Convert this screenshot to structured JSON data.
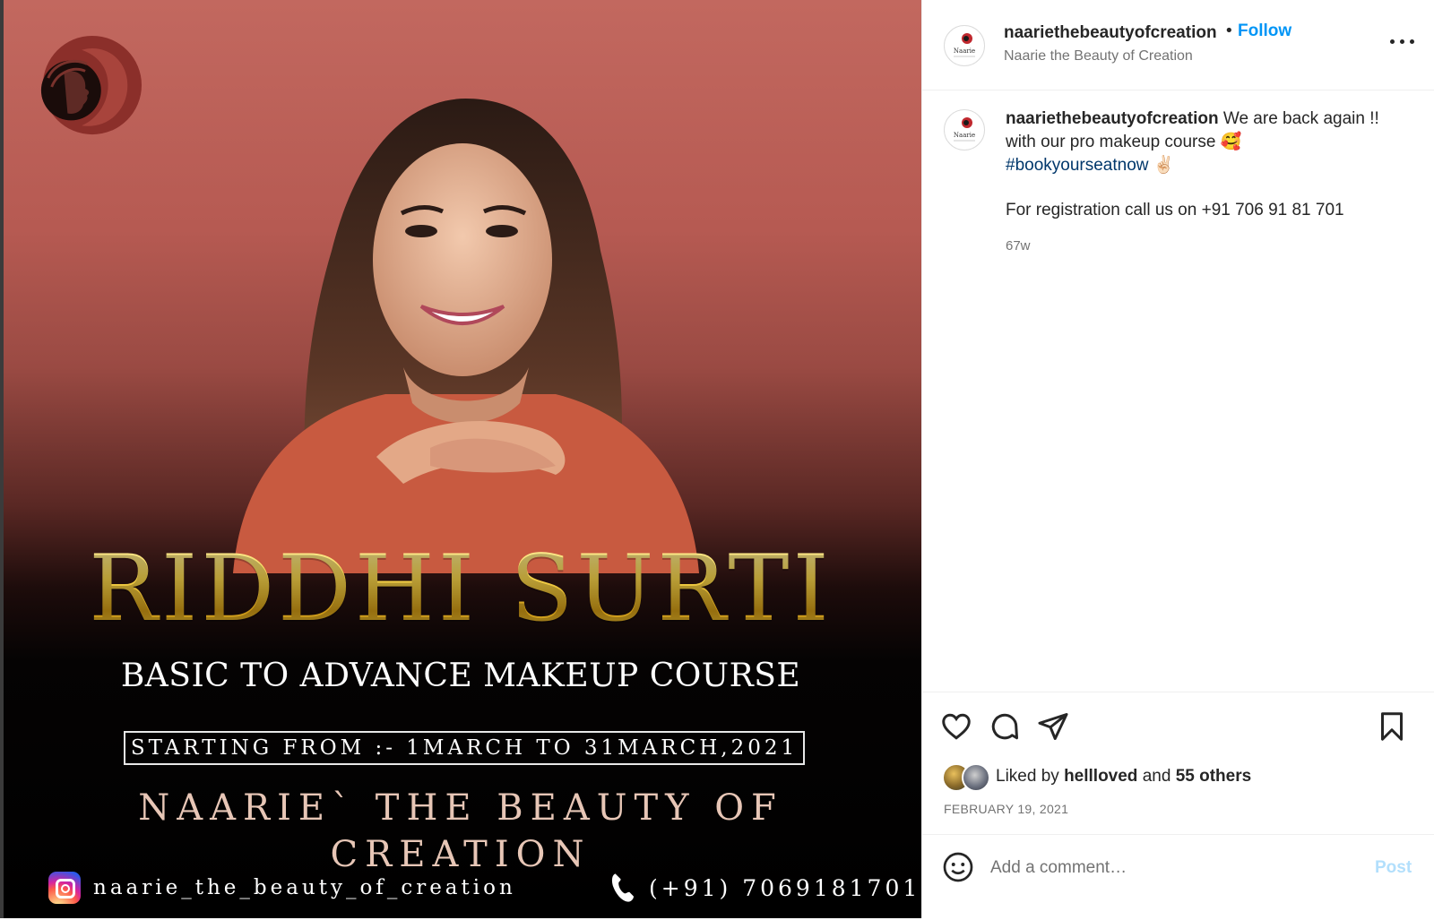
{
  "media": {
    "headline": "RIDDHI SURTI",
    "course": "BASIC TO ADVANCE MAKEUP COURSE",
    "dates": "STARTING FROM :- 1MARCH TO 31MARCH,2021",
    "brand": "NAARIE` THE BEAUTY OF CREATION",
    "instagram_handle": "naarie_the_beauty_of_creation",
    "phone": "(+91) 7069181701",
    "logo_icon": "woman-silhouette-logo",
    "colors": {
      "background_top": "#c2685f",
      "headline_gold": "#f3cd3a"
    }
  },
  "header": {
    "username": "naariethebeautyofcreation",
    "separator": "•",
    "follow_label": "Follow",
    "subtitle": "Naarie the Beauty of Creation",
    "avatar_text": "Naarie",
    "more_icon": "more-horizontal-icon"
  },
  "caption": {
    "username": "naariethebeautyofcreation",
    "text_1": "We are back again !!",
    "text_2": "with our pro makeup course 🥰",
    "hashtag": "#bookyourseatnow",
    "hashtag_emoji": "✌🏻",
    "text_3": "For registration call us on +91 706 91 81 701",
    "age": "67w"
  },
  "actions": {
    "like_icon": "heart-icon",
    "comment_icon": "comment-icon",
    "share_icon": "share-icon",
    "save_icon": "bookmark-icon",
    "liked_prefix": "Liked by",
    "liked_user": "hellloved",
    "liked_and": "and",
    "liked_others": "55 others",
    "date": "FEBRUARY 19, 2021"
  },
  "comment": {
    "emoji_icon": "emoji-icon",
    "placeholder": "Add a comment…",
    "post_label": "Post",
    "post_color": "#b2dffc"
  },
  "colors": {
    "link_blue": "#0095f6",
    "hashtag": "#00376b",
    "text": "#262626",
    "muted": "#737373"
  }
}
